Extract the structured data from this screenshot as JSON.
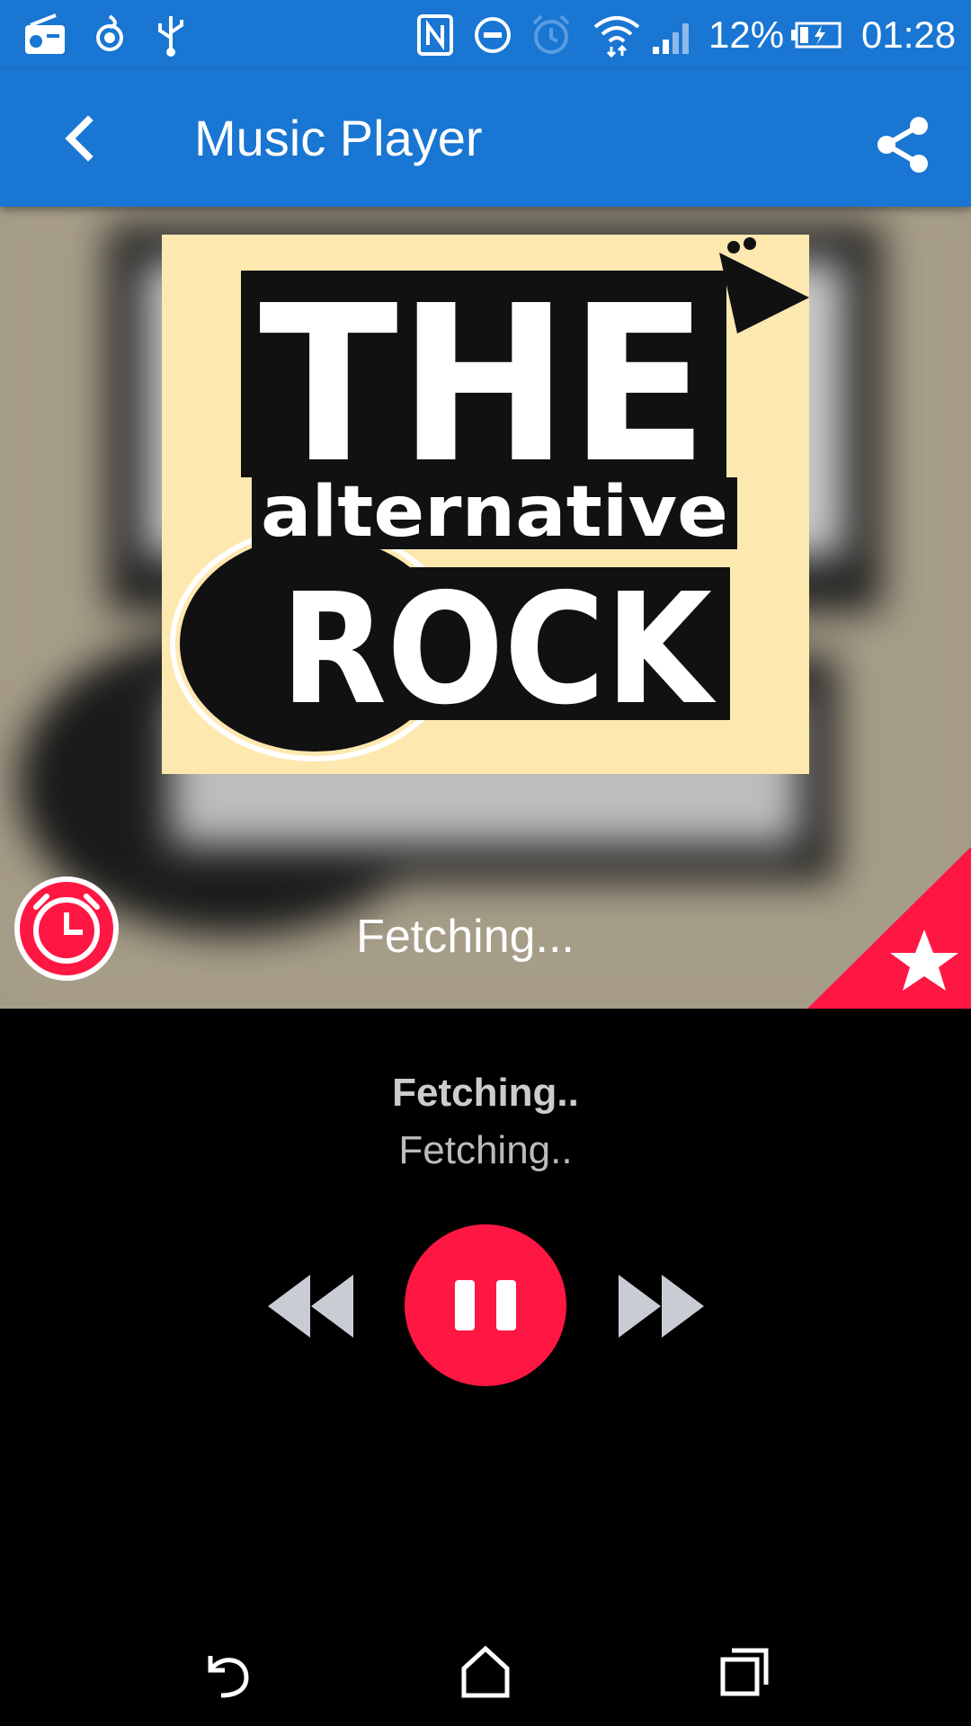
{
  "status_bar": {
    "icons": [
      "radio-icon",
      "hotspot-icon",
      "usb-icon",
      "nfc-icon",
      "do-not-disturb-icon",
      "alarm-icon",
      "wifi-icon",
      "signal-icon",
      "battery-charging-icon"
    ],
    "battery": "12%",
    "time": "01:28"
  },
  "app_bar": {
    "title": "Music Player",
    "back_icon": "chevron-left-icon",
    "share_icon": "share-icon"
  },
  "artwork": {
    "logo_text": [
      "THE",
      "alternative",
      "ROCK"
    ],
    "status": "Fetching...",
    "alarm_icon": "alarm-clock-icon",
    "favorite_icon": "star-icon"
  },
  "track": {
    "title": "Fetching..",
    "artist": "Fetching.."
  },
  "controls": {
    "rewind_icon": "rewind-icon",
    "pause_icon": "pause-icon",
    "forward_icon": "fast-forward-icon"
  },
  "nav_bar": {
    "icons": [
      "back-icon",
      "home-icon",
      "recents-icon"
    ]
  },
  "colors": {
    "app_bar": "#1976D2",
    "accent": "#FF1744",
    "background": "#000000"
  }
}
